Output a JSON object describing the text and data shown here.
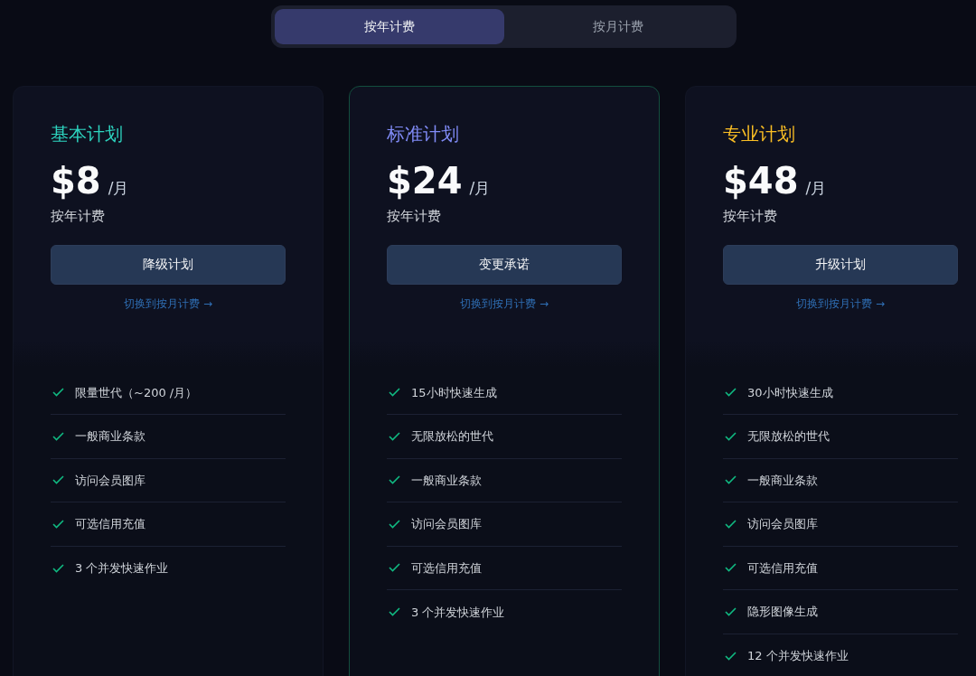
{
  "billing_toggle": [
    {
      "label": "按年计费",
      "selected": true
    },
    {
      "label": "按月计费",
      "selected": false
    }
  ],
  "plans": [
    {
      "name": "基本计划",
      "color": "#2dd4bf",
      "price": "$8",
      "unit": "/月",
      "billing": "按年计费",
      "button": "降级计划",
      "switch_link": "切换到按月计费 →",
      "highlighted": false,
      "features": [
        "限量世代（~200 /月）",
        "一般商业条款",
        "访问会员图库",
        "可选信用充值",
        "3 个并发快速作业"
      ]
    },
    {
      "name": "标准计划",
      "color": "#818cf8",
      "price": "$24",
      "unit": "/月",
      "billing": "按年计费",
      "button": "变更承诺",
      "switch_link": "切换到按月计费 →",
      "highlighted": true,
      "features": [
        "15小时快速生成",
        "无限放松的世代",
        "一般商业条款",
        "访问会员图库",
        "可选信用充值",
        "3 个并发快速作业"
      ]
    },
    {
      "name": "专业计划",
      "color": "#fbbf24",
      "price": "$48",
      "unit": "/月",
      "billing": "按年计费",
      "button": "升级计划",
      "switch_link": "切换到按月计费 →",
      "highlighted": false,
      "features": [
        "30小时快速生成",
        "无限放松的世代",
        "一般商业条款",
        "访问会员图库",
        "可选信用充值",
        "隐形图像生成",
        "12 个并发快速作业"
      ]
    }
  ]
}
